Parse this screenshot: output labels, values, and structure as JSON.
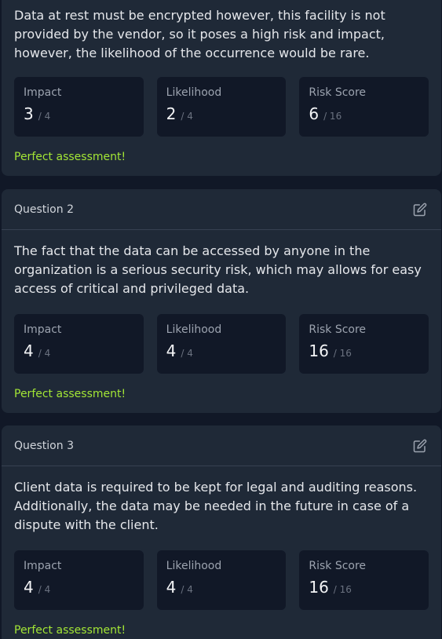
{
  "questions": [
    {
      "title": "",
      "answer": "Data at rest must be encrypted however, this facility is not provided by the vendor, so it poses a high risk and impact, however, the likelihood of the occurrence would be rare.",
      "impact": {
        "label": "Impact",
        "value": "3",
        "max": "/ 4"
      },
      "likelihood": {
        "label": "Likelihood",
        "value": "2",
        "max": "/ 4"
      },
      "risk": {
        "label": "Risk Score",
        "value": "6",
        "max": "/ 16"
      },
      "feedback": "Perfect assessment!"
    },
    {
      "title": "Question 2",
      "answer": "The fact that the data can be accessed by anyone in the organization is a serious security risk, which may allows for easy access of critical and privileged data.",
      "impact": {
        "label": "Impact",
        "value": "4",
        "max": "/ 4"
      },
      "likelihood": {
        "label": "Likelihood",
        "value": "4",
        "max": "/ 4"
      },
      "risk": {
        "label": "Risk Score",
        "value": "16",
        "max": "/ 16"
      },
      "feedback": "Perfect assessment!"
    },
    {
      "title": "Question 3",
      "answer": "Client data is required to be kept for legal and auditing reasons. Additionally, the data may be needed in the future in case of a dispute with the client.",
      "impact": {
        "label": "Impact",
        "value": "4",
        "max": "/ 4"
      },
      "likelihood": {
        "label": "Likelihood",
        "value": "4",
        "max": "/ 4"
      },
      "risk": {
        "label": "Risk Score",
        "value": "16",
        "max": "/ 16"
      },
      "feedback": "Perfect assessment!"
    }
  ],
  "icons": {
    "edit": "edit-icon"
  },
  "colors": {
    "page_bg": "#111827",
    "card_bg": "#1f2937",
    "feedback": "#a3e635"
  }
}
